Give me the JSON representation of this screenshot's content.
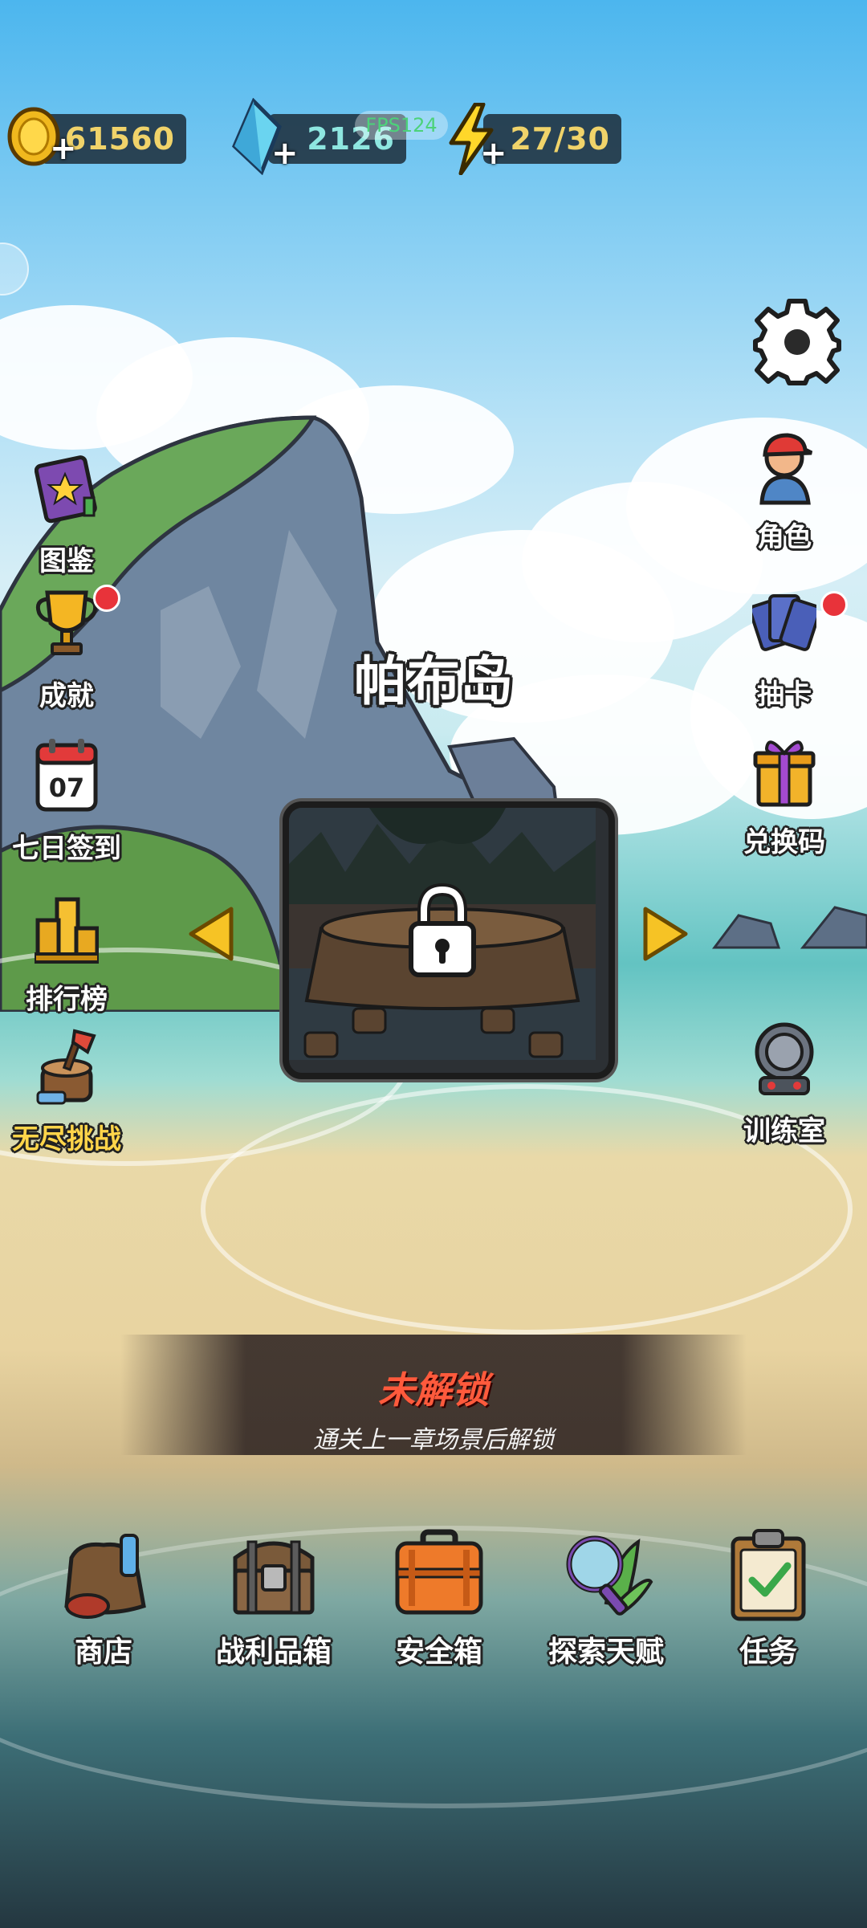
{
  "resources": {
    "gold": {
      "value": "61560",
      "icon": "gold-coin-icon"
    },
    "gems": {
      "value": "2126",
      "icon": "blue-crystal-icon"
    },
    "energy": {
      "value": "27/30",
      "icon": "lightning-icon"
    }
  },
  "fps_label": "FPS124",
  "left_menu": [
    {
      "label": "图鉴",
      "icon": "book-icon",
      "badge": false
    },
    {
      "label": "成就",
      "icon": "trophy-icon",
      "badge": true
    },
    {
      "label": "七日签到",
      "icon": "calendar-icon",
      "badge": false,
      "calendar_day": "07"
    },
    {
      "label": "排行榜",
      "icon": "podium-icon",
      "badge": false
    },
    {
      "label": "无尽挑战",
      "icon": "axe-stump-icon",
      "badge": false
    }
  ],
  "right_menu": [
    {
      "label": "角色",
      "icon": "character-icon",
      "badge": false
    },
    {
      "label": "抽卡",
      "icon": "cards-icon",
      "badge": true
    },
    {
      "label": "兑换码",
      "icon": "gift-icon",
      "badge": false
    },
    {
      "label": "训练室",
      "icon": "training-machine-icon",
      "badge": false
    }
  ],
  "settings_icon": "gear-icon",
  "stage": {
    "name": "帕布岛",
    "locked": true,
    "status_title": "未解锁",
    "status_desc": "通关上一章场景后解锁"
  },
  "bottom_nav": [
    {
      "label": "商店",
      "icon": "shop-bag-icon"
    },
    {
      "label": "战利品箱",
      "icon": "treasure-chest-icon"
    },
    {
      "label": "安全箱",
      "icon": "safe-case-icon"
    },
    {
      "label": "探索天赋",
      "icon": "magnifier-icon"
    },
    {
      "label": "任务",
      "icon": "clipboard-icon"
    }
  ],
  "colors": {
    "accent_gold": "#f0d36a",
    "locked_red": "#ff5a3c",
    "badge_red": "#e8333a",
    "arrow_yellow": "#f6c325"
  }
}
